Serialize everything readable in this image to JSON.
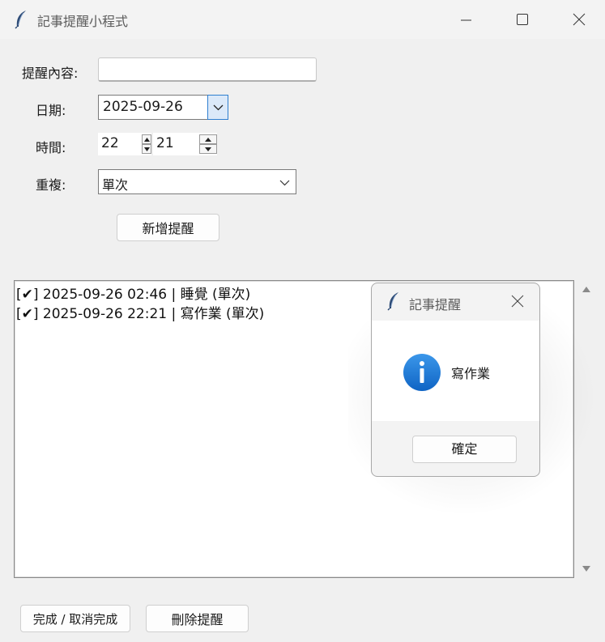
{
  "window": {
    "title": "記事提醒小程式",
    "icons": {
      "app": "feather-icon",
      "minimize": "minimize-icon",
      "maximize": "maximize-icon",
      "close": "close-icon"
    }
  },
  "form": {
    "content_label": "提醒內容:",
    "content_value": "",
    "date_label": "日期:",
    "date_value": "2025-09-26",
    "time_label": "時間:",
    "hour_value": "22",
    "minute_value": "21",
    "repeat_label": "重複:",
    "repeat_value": "單次",
    "add_button": "新增提醒"
  },
  "reminders": [
    {
      "text": "[✔] 2025-09-26 02:46 | 睡覺 (單次)"
    },
    {
      "text": "[✔] 2025-09-26 22:21 | 寫作業 (單次)"
    }
  ],
  "bottom": {
    "toggle_button": "完成 / 取消完成",
    "delete_button": "刪除提醒"
  },
  "dialog": {
    "title": "記事提醒",
    "message": "寫作業",
    "ok_button": "確定",
    "icon": "info-icon"
  },
  "colors": {
    "accent": "#2f7fd0",
    "info_icon": "#1c7ad8",
    "window_bg": "#f0f0f0"
  }
}
